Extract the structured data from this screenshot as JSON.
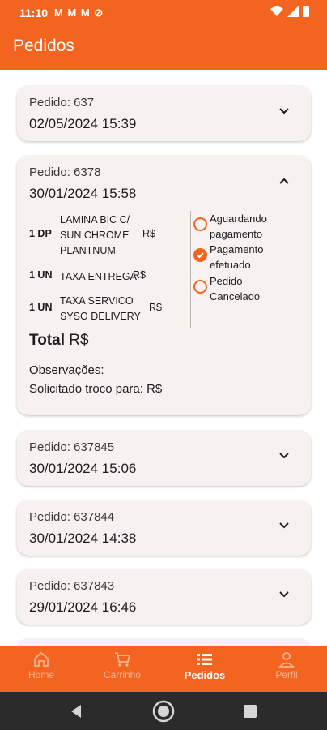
{
  "status_bar": {
    "time": "11:10",
    "notification_icons": [
      "mail-icon",
      "mail-icon",
      "mail-icon",
      "no-disturb-icon"
    ],
    "notifications_text": "M M M ⊘"
  },
  "app_bar": {
    "title": "Pedidos"
  },
  "orders": [
    {
      "label": "Pedido: 637",
      "date": "02/05/2024 15:39",
      "expanded": false
    },
    {
      "label": "Pedido: 6378",
      "date": "30/01/2024 15:58",
      "expanded": true,
      "items": [
        {
          "qty": "1 DP",
          "desc": "LAMINA BIC C/ SUN CHROME PLANTNUM",
          "price": "R$"
        },
        {
          "qty": "1 UN",
          "desc": "TAXA ENTREGA",
          "price": "R$"
        },
        {
          "qty": "1 UN",
          "desc": "TAXA SERVICO SYSO DELIVERY",
          "price": "R$"
        }
      ],
      "statuses": [
        {
          "label": "Aguardando pagamento",
          "checked": false
        },
        {
          "label": "Pagamento efetuado",
          "checked": true
        },
        {
          "label": "Pedido Cancelado",
          "checked": false
        }
      ],
      "total_label": "Total",
      "total_value": "R$",
      "observations_label": "Observações:",
      "change_label": "Solicitado troco para: R$"
    },
    {
      "label": "Pedido: 637845",
      "date": "30/01/2024 15:06",
      "expanded": false
    },
    {
      "label": "Pedido: 637844",
      "date": "30/01/2024 14:38",
      "expanded": false
    },
    {
      "label": "Pedido: 637843",
      "date": "29/01/2024 16:46",
      "expanded": false
    }
  ],
  "bottom_nav": [
    {
      "label": "Home",
      "icon": "home-icon",
      "active": false
    },
    {
      "label": "Carrinho",
      "icon": "cart-icon",
      "active": false
    },
    {
      "label": "Pedidos",
      "icon": "list-icon",
      "active": true
    },
    {
      "label": "Perfil",
      "icon": "person-icon",
      "active": false
    }
  ],
  "colors": {
    "accent": "#f2641f",
    "card": "#f7f2ef"
  }
}
